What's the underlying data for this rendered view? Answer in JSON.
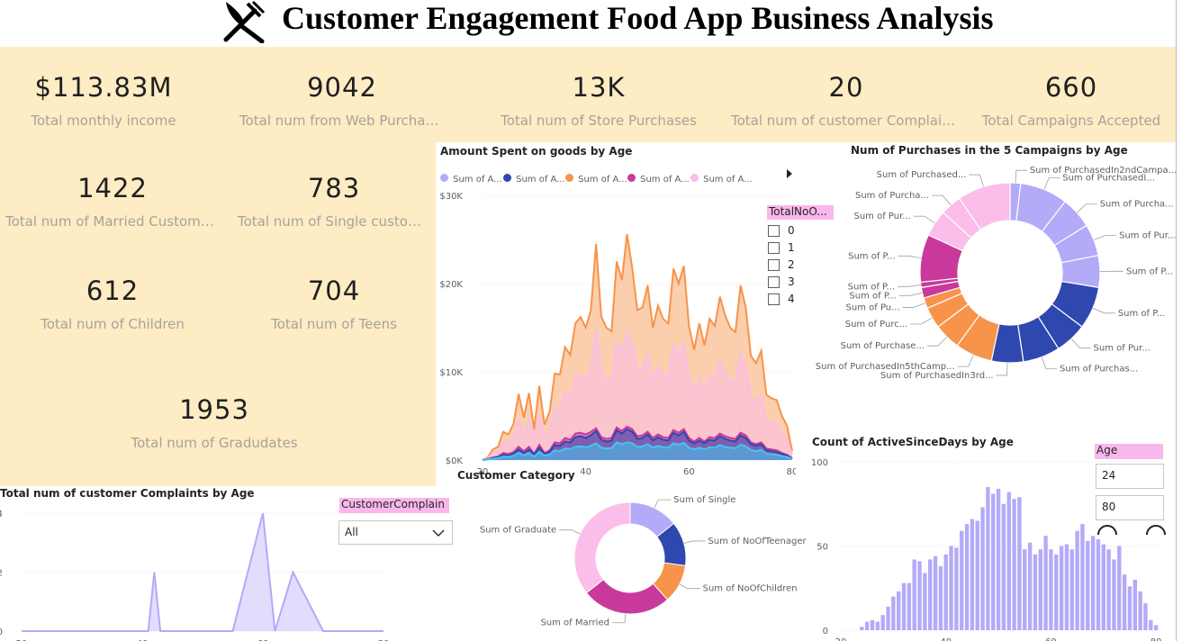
{
  "title": "Customer Engagement Food App Business Analysis",
  "kpis": {
    "income": {
      "value": "$113.83M",
      "label": "Total monthly income"
    },
    "web": {
      "value": "9042",
      "label": "Total num from Web Purchases"
    },
    "store": {
      "value": "13K",
      "label": "Total num of Store Purchases"
    },
    "complaints": {
      "value": "20",
      "label": "Total num of customer Complaints"
    },
    "campaigns": {
      "value": "660",
      "label": "Total Campaigns Accepted"
    },
    "married": {
      "value": "1422",
      "label": "Total num of Married Customers"
    },
    "single": {
      "value": "783",
      "label": "Total num of Single custom..."
    },
    "children": {
      "value": "612",
      "label": "Total num of Children"
    },
    "teens": {
      "value": "704",
      "label": "Total num of Teens"
    },
    "graduates": {
      "value": "1953",
      "label": "Total num of Gradudates"
    }
  },
  "colors": {
    "kpi_bg": "#fdecc4",
    "lavender": "#b3aaf8",
    "navy": "#2f48b0",
    "orange": "#f7934a",
    "magenta": "#c9399b",
    "pink": "#fbbde9",
    "cyan": "#41c7f0",
    "slicer_head": "#f9b7ec"
  },
  "slicers": {
    "total_no": {
      "header": "TotalNoO...",
      "options": [
        "0",
        "1",
        "2",
        "3",
        "4"
      ]
    },
    "customer_complain": {
      "header": "CustomerComplain",
      "value": "All"
    },
    "age": {
      "header": "Age",
      "min": "24",
      "max": "80"
    }
  },
  "chart_data": [
    {
      "type": "area",
      "title": "Amount Spent on goods by Age",
      "legend": [
        "Sum of A...",
        "Sum of A...",
        "Sum of A...",
        "Sum of A...",
        "Sum of A..."
      ],
      "x": [
        20,
        21,
        22,
        23,
        24,
        25,
        26,
        27,
        28,
        29,
        30,
        31,
        32,
        33,
        34,
        35,
        36,
        37,
        38,
        39,
        40,
        41,
        42,
        43,
        44,
        45,
        46,
        47,
        48,
        49,
        50,
        51,
        52,
        53,
        54,
        55,
        56,
        57,
        58,
        59,
        60,
        61,
        62,
        63,
        64,
        65,
        66,
        67,
        68,
        69,
        70,
        71,
        72,
        73,
        74,
        75,
        76,
        77,
        78,
        79,
        80
      ],
      "xticks": [
        "20",
        "40",
        "60",
        "80"
      ],
      "yticks": [
        "$0K",
        "$10K",
        "$20K",
        "$30K"
      ],
      "ylim": [
        0,
        30000
      ],
      "series": [
        {
          "color": "#f7934a",
          "values": [
            0,
            300,
            1200,
            1500,
            3200,
            2900,
            4100,
            7500,
            4800,
            7600,
            3500,
            8400,
            4000,
            5500,
            9800,
            9700,
            12800,
            11900,
            15500,
            16200,
            15000,
            17000,
            24500,
            16300,
            15000,
            14600,
            22500,
            20400,
            25600,
            21800,
            17000,
            17300,
            19800,
            15000,
            17500,
            16000,
            15500,
            21700,
            20000,
            22000,
            15200,
            12500,
            15500,
            13000,
            16000,
            15200,
            18500,
            16400,
            15000,
            14500,
            19800,
            17300,
            11800,
            11000,
            12400,
            7400,
            7000,
            6800,
            5000,
            3900,
            1000
          ]
        },
        {
          "color": "#fbbde9",
          "values": [
            0,
            200,
            800,
            1000,
            2000,
            1900,
            2500,
            4500,
            2900,
            4600,
            2100,
            5000,
            2400,
            3300,
            5900,
            5800,
            7700,
            7100,
            9300,
            9700,
            9000,
            10200,
            14700,
            9800,
            9000,
            8800,
            13500,
            12200,
            14400,
            13100,
            10200,
            10400,
            11900,
            9000,
            10500,
            9600,
            9300,
            13000,
            12000,
            13200,
            9100,
            7500,
            9300,
            7800,
            9600,
            9100,
            11100,
            9800,
            9000,
            8700,
            11900,
            10400,
            7100,
            6600,
            7400,
            4400,
            4200,
            4100,
            3000,
            2300,
            600
          ]
        },
        {
          "color": "#c9399b",
          "values": [
            0,
            100,
            300,
            400,
            800,
            700,
            900,
            1500,
            1000,
            1500,
            700,
            1700,
            800,
            1100,
            2000,
            1900,
            2500,
            2300,
            3000,
            3100,
            2900,
            3200,
            3600,
            2600,
            2400,
            2500,
            3700,
            3300,
            3800,
            3500,
            2700,
            2800,
            3200,
            2500,
            2900,
            2600,
            2500,
            3400,
            3100,
            3500,
            2500,
            2100,
            2500,
            2100,
            2600,
            2500,
            3000,
            2700,
            2500,
            2400,
            3100,
            2800,
            2000,
            1800,
            2000,
            1300,
            1200,
            1100,
            800,
            600,
            200
          ]
        },
        {
          "color": "#2f48b0",
          "values": [
            0,
            80,
            200,
            300,
            600,
            500,
            700,
            1200,
            800,
            1200,
            600,
            1400,
            700,
            900,
            1700,
            1600,
            2100,
            2000,
            2600,
            2700,
            2500,
            2800,
            3300,
            2300,
            2100,
            2200,
            3400,
            3000,
            3500,
            3200,
            2400,
            2500,
            2900,
            2200,
            2600,
            2300,
            2200,
            3100,
            2800,
            3200,
            2200,
            1900,
            2200,
            1900,
            2300,
            2200,
            2700,
            2400,
            2200,
            2100,
            2800,
            2500,
            1800,
            1600,
            1800,
            1100,
            1000,
            900,
            700,
            500,
            150
          ]
        },
        {
          "color": "#41c7f0",
          "values": [
            0,
            50,
            150,
            200,
            400,
            350,
            500,
            800,
            550,
            800,
            400,
            900,
            500,
            650,
            1100,
            1000,
            1300,
            1250,
            1500,
            1550,
            1450,
            1600,
            1900,
            1400,
            1300,
            1350,
            2000,
            1800,
            2000,
            1900,
            1500,
            1550,
            1800,
            1400,
            1600,
            1450,
            1400,
            1900,
            1750,
            1950,
            1400,
            1200,
            1400,
            1200,
            1450,
            1400,
            1700,
            1500,
            1400,
            1350,
            1750,
            1550,
            1150,
            1000,
            1150,
            700,
            650,
            600,
            450,
            350,
            100
          ]
        }
      ]
    },
    {
      "type": "pie",
      "title": "Num of Purchases in the 5 Campaigns by Age",
      "labels": [
        "Sum of PurchasedIn2ndCampa...",
        "Sum of PurchasedI...",
        "Sum of Purcha...",
        "Sum of Pur...",
        "Sum of P...",
        "Sum of P...",
        "Sum of Pur...",
        "Sum of Purchas...",
        "Sum of PurchasedIn3rd...",
        "Sum of PurchasedIn5thCamp...",
        "Sum of Purchase...",
        "Sum of Purc...",
        "Sum of Pu...",
        "Sum of P...",
        "Sum of P...",
        "Sum of P...",
        "Sum of Pur...",
        "Sum of Purcha...",
        "Sum of Purchased..."
      ],
      "colors": [
        "#b3aaf8",
        "#b3aaf8",
        "#b3aaf8",
        "#b3aaf8",
        "#b3aaf8",
        "#2f48b0",
        "#2f48b0",
        "#2f48b0",
        "#2f48b0",
        "#f7934a",
        "#f7934a",
        "#f7934a",
        "#f7934a",
        "#c9399b",
        "#c9399b",
        "#c9399b",
        "#fbbde9",
        "#fbbde9",
        "#fbbde9"
      ],
      "values": [
        2,
        9,
        6,
        6,
        6,
        8,
        6,
        7,
        6,
        7,
        5,
        4,
        2,
        2,
        1,
        9,
        5,
        4,
        10
      ]
    },
    {
      "type": "area",
      "title": "Total num of customer Complaints by Age",
      "x": [
        20,
        30,
        41,
        42,
        43,
        50,
        55,
        60,
        62,
        65,
        70,
        80
      ],
      "values": [
        0,
        0,
        0,
        2,
        0,
        0,
        0,
        4,
        0,
        2,
        0,
        0
      ],
      "xticks": [
        "20",
        "40",
        "60",
        "80"
      ],
      "yticks": [
        "0",
        "2",
        "4"
      ],
      "ylim": [
        0,
        4
      ]
    },
    {
      "type": "pie",
      "title": "Customer Category",
      "labels": [
        "Sum of Single",
        "Sum of NoOfTeenager",
        "Sum of NoOfChildren",
        "Sum of Married",
        "Sum of Graduate"
      ],
      "values": [
        783,
        704,
        612,
        1422,
        1953
      ],
      "colors": [
        "#b3aaf8",
        "#2f48b0",
        "#f7934a",
        "#c9399b",
        "#fbbde9"
      ]
    },
    {
      "type": "bar",
      "title": "Count of ActiveSinceDays by Age",
      "x": [
        24,
        25,
        26,
        27,
        28,
        29,
        30,
        31,
        32,
        33,
        34,
        35,
        36,
        37,
        38,
        39,
        40,
        41,
        42,
        43,
        44,
        45,
        46,
        47,
        48,
        49,
        50,
        51,
        52,
        53,
        54,
        55,
        56,
        57,
        58,
        59,
        60,
        61,
        62,
        63,
        64,
        65,
        66,
        67,
        68,
        69,
        70,
        71,
        72,
        73,
        74,
        75,
        76,
        77,
        78,
        79,
        80
      ],
      "values": [
        2,
        5,
        6,
        5,
        9,
        14,
        20,
        23,
        28,
        28,
        42,
        41,
        34,
        42,
        44,
        38,
        45,
        50,
        49,
        59,
        63,
        66,
        65,
        73,
        85,
        81,
        84,
        75,
        82,
        78,
        79,
        48,
        52,
        45,
        48,
        56,
        48,
        45,
        50,
        51,
        48,
        59,
        63,
        53,
        56,
        54,
        51,
        48,
        42,
        50,
        33,
        26,
        30,
        23,
        16,
        6,
        3
      ],
      "xticks": [
        "20",
        "40",
        "60",
        "80"
      ],
      "yticks": [
        "0",
        "50",
        "100"
      ],
      "ylim": [
        0,
        100
      ]
    }
  ]
}
